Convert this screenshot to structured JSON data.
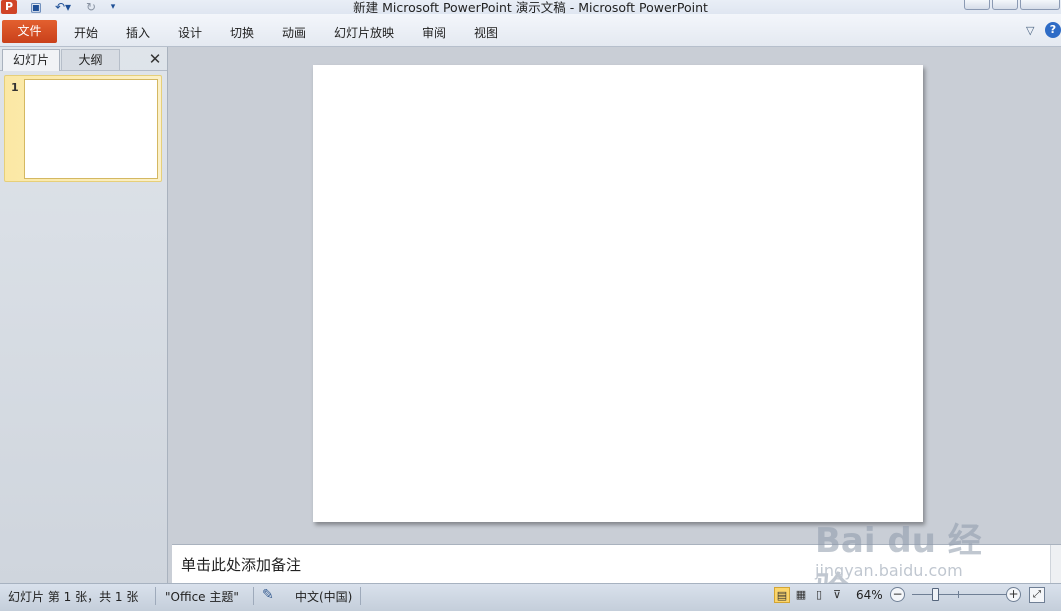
{
  "window": {
    "title": "新建 Microsoft PowerPoint 演示文稿 - Microsoft PowerPoint",
    "app_logo": "P"
  },
  "quick_access": {
    "save_icon": "save-icon",
    "undo_icon": "undo-icon",
    "redo_icon": "redo-icon",
    "customize_icon": "customize-qat-icon"
  },
  "ribbon": {
    "file_tab": "文件",
    "tabs": [
      "开始",
      "插入",
      "设计",
      "切换",
      "动画",
      "幻灯片放映",
      "审阅",
      "视图"
    ],
    "minimize_icon": "chevron-down-icon",
    "help_label": "?"
  },
  "left_panel": {
    "tabs": [
      "幻灯片",
      "大纲"
    ],
    "close_label": "✕",
    "thumbnails": [
      {
        "number": "1"
      }
    ]
  },
  "notes": {
    "placeholder": "单击此处添加备注"
  },
  "status_bar": {
    "slide_info": "幻灯片 第 1 张，共 1 张",
    "theme": "\"Office 主题\"",
    "language": "中文(中国)",
    "zoom": "64%",
    "zoom_level_percent": 64
  },
  "watermark": {
    "logo": "Bai du 经验",
    "url": "jingyan.baidu.com"
  },
  "colors": {
    "file_tab": "#d04a22",
    "workspace": "#c9ced6",
    "selected_thumb": "#fbe8a4"
  }
}
